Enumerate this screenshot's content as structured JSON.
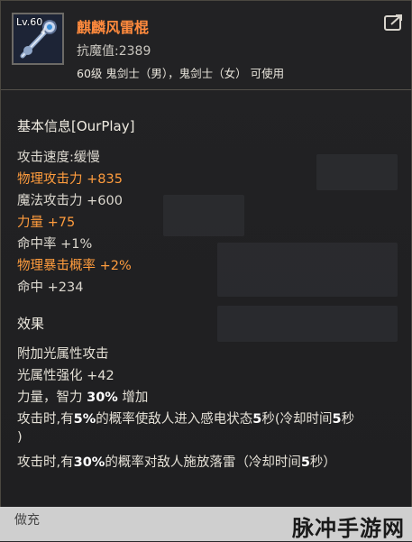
{
  "item": {
    "level": "Lv.60",
    "name": "麒麟风雷棍",
    "anti_magic": "抗魔值:2389",
    "usable_by": "60级 鬼剑士（男），鬼剑士（女） 可使用",
    "icon_name": "staff-weapon-icon"
  },
  "basic_info": {
    "title": "基本信息[OurPlay]",
    "stats": [
      {
        "text": "攻击速度:缓慢",
        "highlight": false
      },
      {
        "text": "物理攻击力 +835",
        "highlight": true
      },
      {
        "text": "魔法攻击力 +600",
        "highlight": false
      },
      {
        "text": "力量 +75",
        "highlight": true
      },
      {
        "text": "命中率 +1%",
        "highlight": false
      },
      {
        "text": "物理暴击概率 +2%",
        "highlight": true
      },
      {
        "text": "命中 +234",
        "highlight": false
      }
    ]
  },
  "effects": {
    "title": "效果",
    "line1": "附加光属性攻击",
    "line2_a": "光属性强化 +",
    "line2_b": "42",
    "line3_a": "力量，智力 ",
    "line3_b": "30%",
    "line3_c": " 增加",
    "line4_a": "攻击时,有",
    "line4_b": "5%",
    "line4_c": "的概率使敌人进入感电状态",
    "line4_d": "5",
    "line4_e": "秒(冷却时间",
    "line4_f": "5",
    "line4_g": "秒",
    "line5": ")",
    "line6_a": "攻击时,有",
    "line6_b": "30%",
    "line6_c": "的概率对敌人施放落雷（冷却时间",
    "line6_d": "5",
    "line6_e": "秒）"
  },
  "footer": {
    "partial_title": "做充",
    "watermark": "脉冲手游网"
  },
  "colors": {
    "name": "#ff8a3d",
    "highlight": "#ff9c3d",
    "text": "#dcd8cf",
    "background": "#222224"
  }
}
